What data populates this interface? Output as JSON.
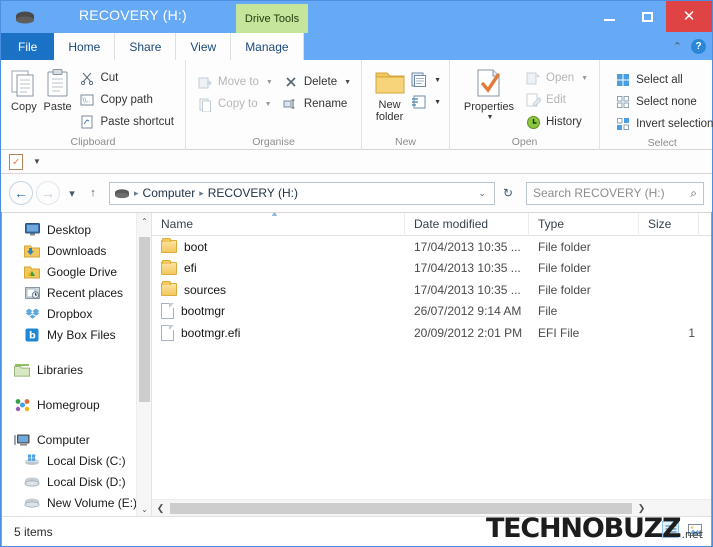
{
  "window": {
    "title": "RECOVERY (H:)",
    "contextual_tab": "Drive Tools",
    "minimize_label": "Minimize",
    "maximize_label": "Maximize",
    "close_label": "Close",
    "drive_icon": "drive-icon",
    "accent_color": "#66a9f5",
    "contextual_tab_color": "#c5e59a",
    "close_button_color": "#e04343"
  },
  "tabs": [
    {
      "label": "File",
      "active": true
    },
    {
      "label": "Home",
      "active": false
    },
    {
      "label": "Share",
      "active": false
    },
    {
      "label": "View",
      "active": false
    },
    {
      "label": "Manage",
      "active": false
    }
  ],
  "ribbon_controls": {
    "collapse_icon": "chevron-up-icon",
    "help_icon": "help-icon",
    "help_label": "?"
  },
  "quick_access": {
    "properties_icon": "properties-icon",
    "dropdown_icon": "chevron-down-icon"
  },
  "ribbon": {
    "groups": [
      {
        "title": "Clipboard",
        "big_buttons": [
          {
            "label": "Copy",
            "icon": "copy-icon"
          },
          {
            "label": "Paste",
            "icon": "paste-icon"
          }
        ],
        "small_buttons": [
          {
            "label": "Cut",
            "icon": "scissors-icon",
            "disabled": false
          },
          {
            "label": "Copy path",
            "icon": "copy-path-icon",
            "disabled": false
          },
          {
            "label": "Paste shortcut",
            "icon": "paste-shortcut-icon",
            "disabled": false
          }
        ]
      },
      {
        "title": "Organise",
        "small_buttons": [
          {
            "label": "Move to",
            "icon": "move-to-icon",
            "disabled": true,
            "has_caret": true
          },
          {
            "label": "Copy to",
            "icon": "copy-to-icon",
            "disabled": true,
            "has_caret": true
          },
          {
            "label": "Delete",
            "icon": "delete-x-icon",
            "disabled": false,
            "has_caret": true
          },
          {
            "label": "Rename",
            "icon": "rename-icon",
            "disabled": false,
            "has_caret": false
          }
        ]
      },
      {
        "title": "New",
        "big_buttons": [
          {
            "label": "New\nfolder",
            "label_line1": "New",
            "label_line2": "folder",
            "icon": "new-folder-icon"
          }
        ],
        "split_buttons": [
          {
            "icon": "new-item-icon",
            "has_caret": true
          },
          {
            "icon": "easy-access-icon",
            "has_caret": true
          }
        ]
      },
      {
        "title": "Open",
        "big_buttons": [
          {
            "label": "Properties",
            "icon": "properties-large-icon",
            "has_caret": true
          }
        ],
        "small_buttons": [
          {
            "label": "Open",
            "icon": "open-icon",
            "disabled": true,
            "has_caret": true
          },
          {
            "label": "Edit",
            "icon": "edit-icon",
            "disabled": true,
            "has_caret": false
          },
          {
            "label": "History",
            "icon": "history-icon",
            "disabled": false,
            "has_caret": false
          }
        ]
      },
      {
        "title": "Select",
        "small_buttons": [
          {
            "label": "Select all",
            "icon": "select-all-icon",
            "disabled": false
          },
          {
            "label": "Select none",
            "icon": "select-none-icon",
            "disabled": false
          },
          {
            "label": "Invert selection",
            "icon": "invert-selection-icon",
            "disabled": false
          }
        ]
      }
    ]
  },
  "navigation": {
    "back_icon": "back-arrow-icon",
    "forward_icon": "forward-arrow-icon",
    "recent_icon": "chevron-down-icon",
    "up_icon": "up-arrow-icon",
    "breadcrumb_icon": "drive-icon",
    "breadcrumb": [
      "Computer",
      "RECOVERY (H:)"
    ],
    "breadcrumb_dropdown_icon": "chevron-down-icon",
    "refresh_icon": "refresh-icon"
  },
  "search": {
    "placeholder": "Search RECOVERY (H:)",
    "value": "",
    "icon": "search-icon"
  },
  "sidebar": {
    "scroll_up_icon": "chevron-up-icon",
    "scroll_down_icon": "chevron-down-icon",
    "items": [
      {
        "label": "Desktop",
        "icon": "desktop-icon",
        "indent": true
      },
      {
        "label": "Downloads",
        "icon": "downloads-folder-icon",
        "indent": true
      },
      {
        "label": "Google Drive",
        "icon": "google-drive-icon",
        "indent": true
      },
      {
        "label": "Recent places",
        "icon": "recent-places-icon",
        "indent": true
      },
      {
        "label": "Dropbox",
        "icon": "dropbox-icon",
        "indent": true
      },
      {
        "label": "My Box Files",
        "icon": "box-icon",
        "indent": true
      },
      {
        "label": "Libraries",
        "icon": "libraries-icon",
        "indent": false,
        "gap_before": true
      },
      {
        "label": "Homegroup",
        "icon": "homegroup-icon",
        "indent": false,
        "gap_before": true
      },
      {
        "label": "Computer",
        "icon": "computer-icon",
        "indent": false,
        "gap_before": true
      },
      {
        "label": "Local Disk (C:)",
        "icon": "windows-disk-icon",
        "indent": true
      },
      {
        "label": "Local Disk (D:)",
        "icon": "disk-icon",
        "indent": true
      },
      {
        "label": "New Volume (E:)",
        "icon": "disk-icon",
        "indent": true
      }
    ]
  },
  "file_list": {
    "columns": [
      {
        "key": "name",
        "label": "Name",
        "sorted": true,
        "sort_icon": "sort-ascending-icon"
      },
      {
        "key": "date",
        "label": "Date modified"
      },
      {
        "key": "type",
        "label": "Type"
      },
      {
        "key": "size",
        "label": "Size"
      }
    ],
    "rows": [
      {
        "name": "boot",
        "date": "17/04/2013 10:35 ...",
        "type": "File folder",
        "size": "",
        "icon": "folder-icon"
      },
      {
        "name": "efi",
        "date": "17/04/2013 10:35 ...",
        "type": "File folder",
        "size": "",
        "icon": "folder-icon"
      },
      {
        "name": "sources",
        "date": "17/04/2013 10:35 ...",
        "type": "File folder",
        "size": "",
        "icon": "folder-icon"
      },
      {
        "name": "bootmgr",
        "date": "26/07/2012 9:14 AM",
        "type": "File",
        "size": "",
        "icon": "file-icon"
      },
      {
        "name": "bootmgr.efi",
        "date": "20/09/2012 2:01 PM",
        "type": "EFI File",
        "size": "1",
        "icon": "file-icon"
      }
    ],
    "h_scroll_left_icon": "chevron-left-icon",
    "h_scroll_right_icon": "chevron-right-icon"
  },
  "status": {
    "text": "5 items",
    "view_details_icon": "details-view-icon",
    "view_icons_icon": "large-icons-view-icon"
  },
  "watermark": {
    "main": "TECHNOBUZZ",
    "tld": ".net"
  }
}
